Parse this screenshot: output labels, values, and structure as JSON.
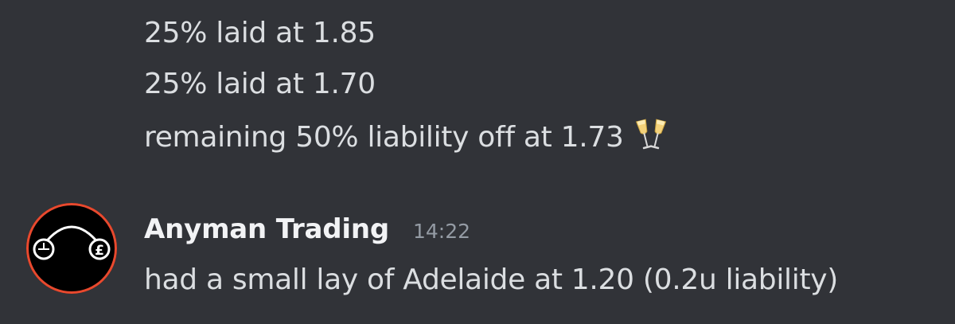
{
  "messages": {
    "previous": {
      "lines": [
        "25% laid at 1.85",
        "25% laid at 1.70",
        "remaining 50% liability off at 1.73"
      ],
      "emoji": "champagne-glasses"
    },
    "latest": {
      "author": "Anyman Trading",
      "timestamp": "14:22",
      "text": "had a small lay of Adelaide at 1.20 (0.2u liability)",
      "avatar_ring_color": "#e8492e"
    }
  },
  "colors": {
    "background": "#313338",
    "text": "#dbdee1",
    "author": "#f2f3f5",
    "timestamp": "#949ba4"
  }
}
